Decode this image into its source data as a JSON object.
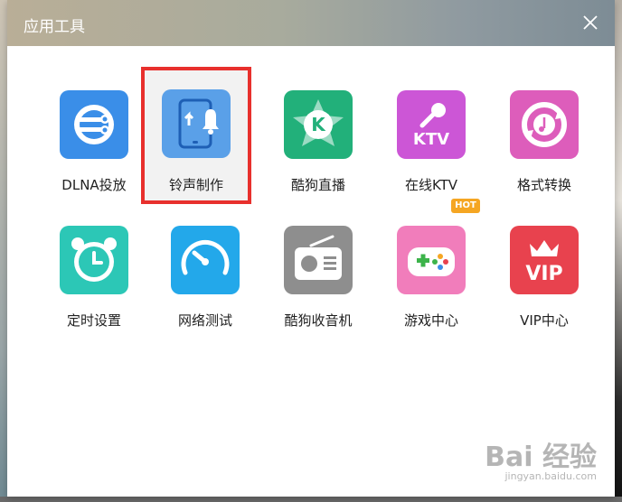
{
  "window": {
    "title": "应用工具"
  },
  "apps": [
    {
      "label": "DLNA投放",
      "icon": "dlna-icon",
      "color": "#3a8ee8"
    },
    {
      "label": "铃声制作",
      "icon": "ringtone-icon",
      "color": "#5aa0e8",
      "selected": true
    },
    {
      "label": "酷狗直播",
      "icon": "live-icon",
      "color": "#22b07a"
    },
    {
      "label": "在线KTV",
      "icon": "ktv-icon",
      "color": "#cc56d6"
    },
    {
      "label": "格式转换",
      "icon": "convert-icon",
      "color": "#dd5dbb"
    },
    {
      "label": "定时设置",
      "icon": "alarm-icon",
      "color": "#2cc7b6"
    },
    {
      "label": "网络测试",
      "icon": "speed-icon",
      "color": "#23a8ea"
    },
    {
      "label": "酷狗收音机",
      "icon": "radio-icon",
      "color": "#8e8e8e"
    },
    {
      "label": "游戏中心",
      "icon": "gamepad-icon",
      "color": "#f17dbb",
      "badge": "HOT"
    },
    {
      "label": "VIP中心",
      "icon": "vip-icon",
      "color": "#e8424e"
    }
  ],
  "watermark": {
    "brand": "Bai 经验",
    "url": "jingyan.baidu.com"
  }
}
